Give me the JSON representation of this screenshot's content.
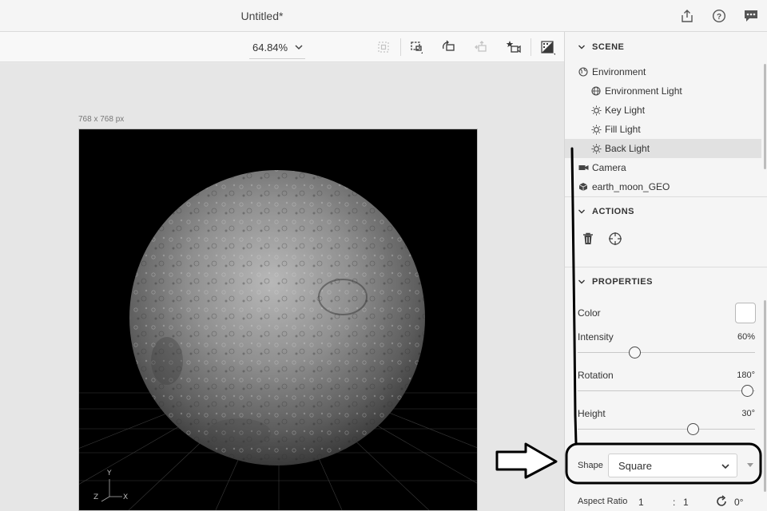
{
  "window": {
    "title": "Untitled*"
  },
  "titlebar_icons": [
    "share-icon",
    "help-icon",
    "feedback-icon"
  ],
  "toolbar": {
    "zoom": "64.84%",
    "tools": [
      "fit-frame-icon",
      "frame-selection-icon",
      "rotate-camera-icon",
      "pan-camera-icon",
      "dolly-camera-icon",
      "render-icon"
    ]
  },
  "canvas": {
    "size_label": "768 x 768 px",
    "axes": {
      "y": "Y",
      "z": "Z",
      "x": "X"
    }
  },
  "scene": {
    "header": "SCENE",
    "items": [
      {
        "label": "Environment",
        "icon": "globe-icon",
        "level": 0
      },
      {
        "label": "Environment Light",
        "icon": "globe-grid-icon",
        "level": 1
      },
      {
        "label": "Key Light",
        "icon": "sun-icon",
        "level": 1
      },
      {
        "label": "Fill Light",
        "icon": "sun-icon",
        "level": 1
      },
      {
        "label": "Back Light",
        "icon": "sun-icon",
        "level": 1,
        "selected": true
      },
      {
        "label": "Camera",
        "icon": "camera-icon",
        "level": 0
      },
      {
        "label": "earth_moon_GEO",
        "icon": "cube-icon",
        "level": 0
      }
    ]
  },
  "actions": {
    "header": "ACTIONS",
    "buttons": [
      "trash-icon",
      "target-icon"
    ]
  },
  "properties": {
    "header": "PROPERTIES",
    "color_label": "Color",
    "color_value": "#ffffff",
    "intensity": {
      "label": "Intensity",
      "value": "60%",
      "fraction": 0.31
    },
    "rotation": {
      "label": "Rotation",
      "value": "180°",
      "fraction": 0.99
    },
    "height": {
      "label": "Height",
      "value": "30°",
      "fraction": 0.66
    },
    "shape": {
      "label": "Shape",
      "value": "Square"
    },
    "aspect_ratio": {
      "label": "Aspect Ratio",
      "a": "1",
      "sep": ":",
      "b": "1",
      "angle": "0°"
    }
  },
  "colors": {
    "accent": "#2c2c2c",
    "selected_row": "#e1e1e1",
    "panel_bg": "#f5f5f5"
  }
}
